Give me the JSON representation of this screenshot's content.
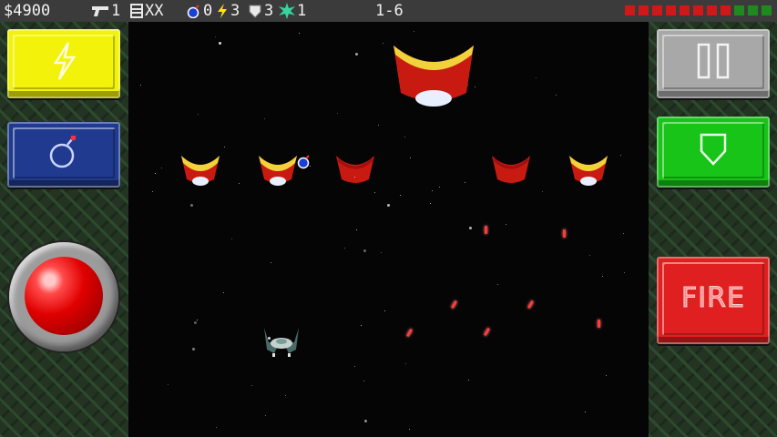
{
  "hud": {
    "money": "$4900",
    "pistol_count": "1",
    "ammo_label": "XX",
    "bomb_count": "0",
    "lightning_count": "3",
    "shield_count": "3",
    "star_count": "1",
    "level": "1-6",
    "health_total": 11,
    "health_filled": 8,
    "health_color_full": "#d01818",
    "health_color_empty": "#1e8a1e"
  },
  "left_panel": {
    "lightning_button_icon": "lightning-icon",
    "bomb_button_icon": "bomb-icon",
    "joystick_icon": "red-ball-joystick"
  },
  "right_panel": {
    "pause_button_icon": "pause-icon",
    "shield_button_icon": "shield-icon",
    "fire_label": "FIRE"
  },
  "colors": {
    "lightning_button": "#f2f20a",
    "bomb_button": "#1f3a8e",
    "pause_button": "#a8a8a8",
    "shield_button": "#18c418",
    "fire_button": "#e02020"
  }
}
